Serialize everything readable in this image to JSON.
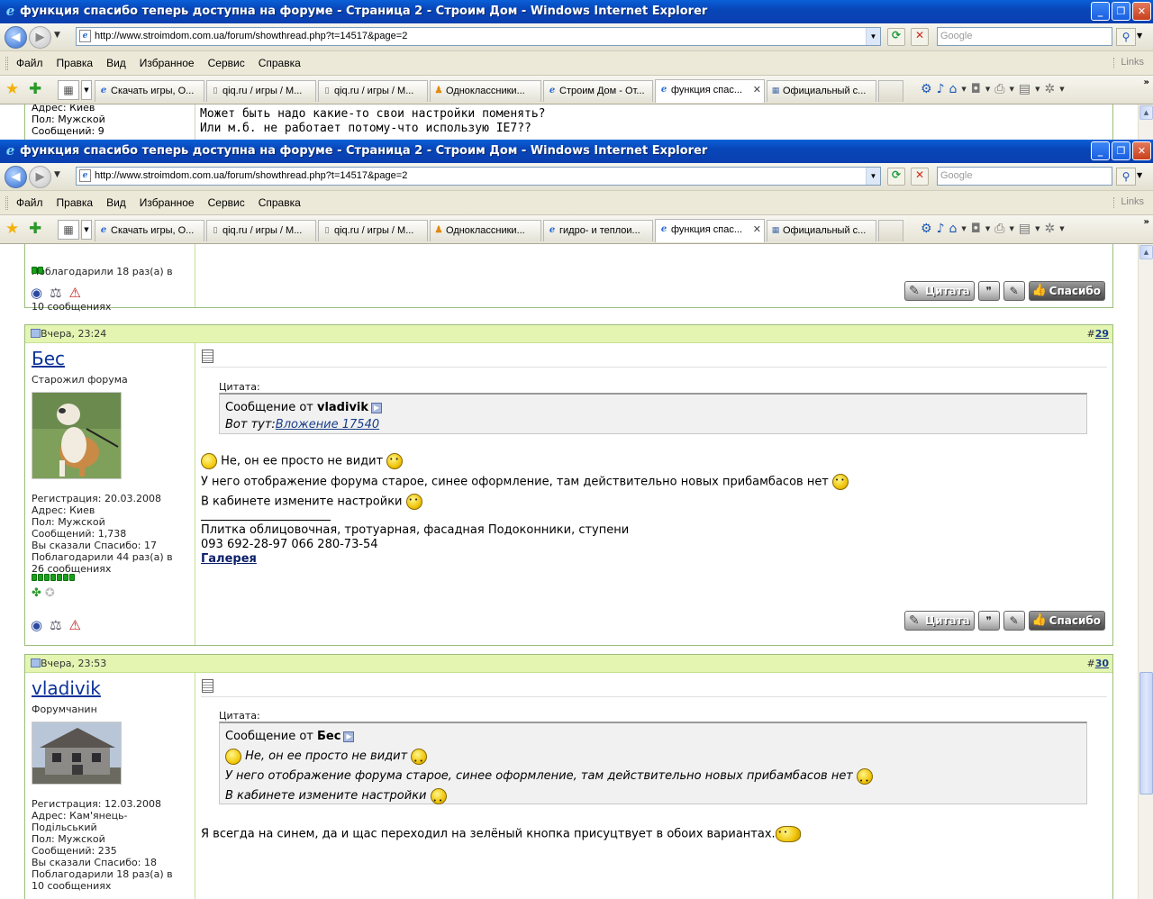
{
  "browser": {
    "window_title": "функция спасибо теперь доступна на форуме - Страница 2 - Строим Дом - Windows Internet Explorer",
    "url": "http://www.stroimdom.com.ua/forum/showthread.php?t=14517&page=2",
    "search_placeholder": "Google",
    "menu": [
      "Файл",
      "Правка",
      "Вид",
      "Избранное",
      "Сервис",
      "Справка"
    ],
    "links_label": "Links",
    "tabs_top": [
      {
        "label": "Скачать игры, О...",
        "icon": "ie-icon"
      },
      {
        "label": "qiq.ru / игры / М...",
        "icon": "page-icon"
      },
      {
        "label": "qiq.ru / игры / М...",
        "icon": "page-icon"
      },
      {
        "label": "Одноклассники...",
        "icon": "people-icon"
      },
      {
        "label": "Строим Дом - От...",
        "icon": "ie-icon"
      },
      {
        "label": "функция спас...",
        "icon": "ie-icon",
        "active": true
      },
      {
        "label": "Официальный с...",
        "icon": "grid-icon"
      }
    ],
    "tabs_bottom": [
      {
        "label": "Скачать игры, О...",
        "icon": "ie-icon"
      },
      {
        "label": "qiq.ru / игры / М...",
        "icon": "page-icon"
      },
      {
        "label": "qiq.ru / игры / М...",
        "icon": "page-icon"
      },
      {
        "label": "Одноклассники...",
        "icon": "people-icon"
      },
      {
        "label": "гидро- и теплои...",
        "icon": "ie-icon"
      },
      {
        "label": "функция спас...",
        "icon": "ie-icon",
        "active": true
      },
      {
        "label": "Официальный с...",
        "icon": "grid-icon"
      }
    ]
  },
  "top_fragment": {
    "left_lines": [
      "Адрес: Киев",
      "Пол: Мужской",
      "Сообщений: 9"
    ],
    "right_lines": [
      "Может быть надо какие-то свои настройки поменять?",
      "Или м.б. не работает потому-что использую IE7??"
    ]
  },
  "prev_post_fragment": {
    "lines": [
      "Поблагодарили 18 раз(а) в",
      "10 сообщениях"
    ]
  },
  "posts": [
    {
      "date": "Вчера, 23:24",
      "number": "29",
      "username": "Бес",
      "user_title": "Старожил форума",
      "info": "Регистрация: 20.03.2008\nАдрес: Киев\nПол: Мужской\nСообщений: 1,738\nВы сказали Спасибо: 17\nПоблагодарили 44 раз(а) в\n26 сообщениях",
      "quote_label": "Цитата:",
      "quote_from_prefix": "Сообщение от ",
      "quote_author": "vladivik",
      "quote_text_prefix": "Вот тут:",
      "quote_link": "Вложение 17540",
      "lines": [
        "Не, он ее просто не видит",
        "У него отображение форума старое, синее оформление, там действительно новых прибамбасов нет",
        "В кабинете измените настройки"
      ],
      "signature": [
        "Плитка облицовочная, тротуарная, фасадная Подоконники, ступени",
        "093 692-28-97 066 280-73-54"
      ],
      "signature_link": "Галерея"
    },
    {
      "date": "Вчера, 23:53",
      "number": "30",
      "username": "vladivik",
      "user_title": "Форумчанин",
      "info": "Регистрация: 12.03.2008\nАдрес: Кам'янець-\nПодільський\nПол: Мужской\nСообщений: 235\nВы сказали Спасибо: 18\nПоблагодарили 18 раз(а) в\n10 сообщениях",
      "quote_label": "Цитата:",
      "quote_from_prefix": "Сообщение от ",
      "quote_author": "Бес",
      "quote_lines": [
        "Не, он ее просто не видит",
        "У него отображение форума старое, синее оформление, там действительно новых прибамбасов нет",
        "В кабинете измените настройки"
      ],
      "lines": [
        "Я всегда на синем, да и щас переходил на зелёный кнопка присуцтвует в обоих вариантах."
      ]
    }
  ],
  "buttons": {
    "quote": "Цитата",
    "thanks": "Спасибо"
  }
}
